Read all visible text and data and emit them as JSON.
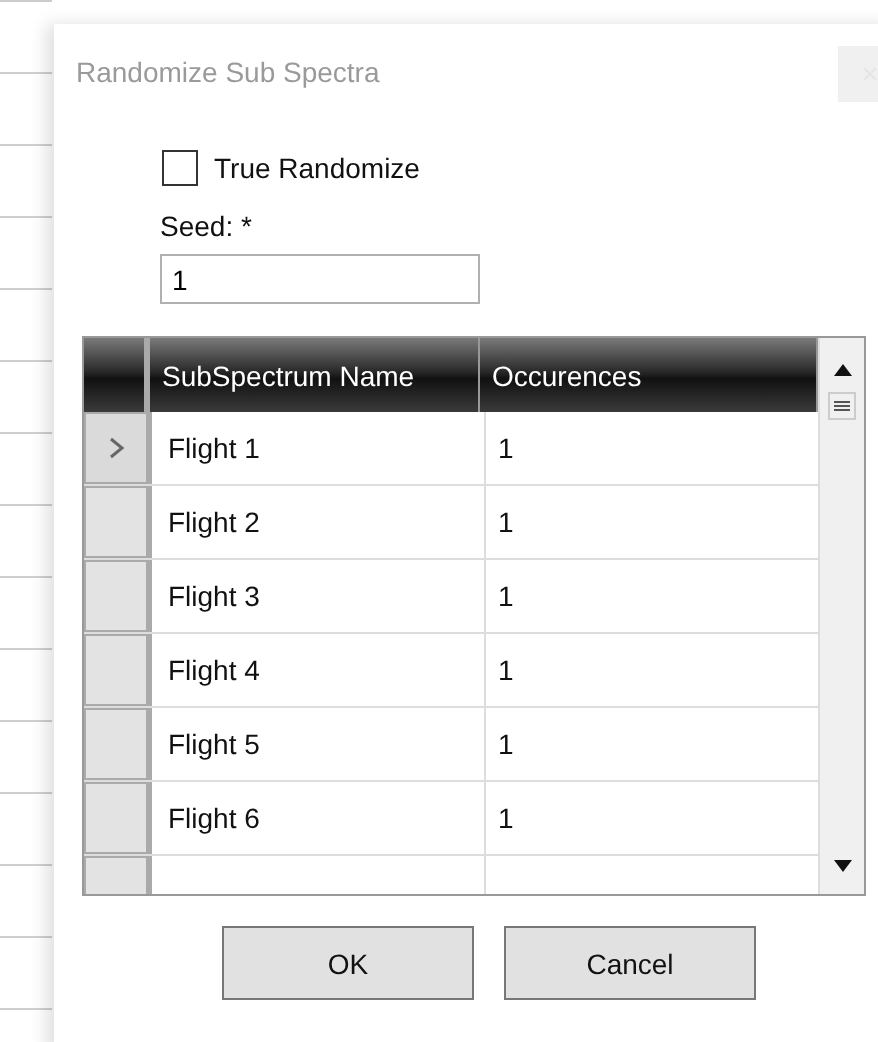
{
  "dialog": {
    "title": "Randomize Sub Spectra"
  },
  "true_randomize": {
    "label": "True Randomize",
    "checked": false
  },
  "seed": {
    "label": "Seed: *",
    "value": "1"
  },
  "grid": {
    "columns": [
      "SubSpectrum Name",
      "Occurences"
    ],
    "rows": [
      {
        "name": "Flight 1",
        "occurences": "1",
        "selected": true
      },
      {
        "name": "Flight 2",
        "occurences": "1",
        "selected": false
      },
      {
        "name": "Flight 3",
        "occurences": "1",
        "selected": false
      },
      {
        "name": "Flight 4",
        "occurences": "1",
        "selected": false
      },
      {
        "name": "Flight 5",
        "occurences": "1",
        "selected": false
      },
      {
        "name": "Flight 6",
        "occurences": "1",
        "selected": false
      }
    ]
  },
  "buttons": [
    "OK",
    "Cancel"
  ]
}
